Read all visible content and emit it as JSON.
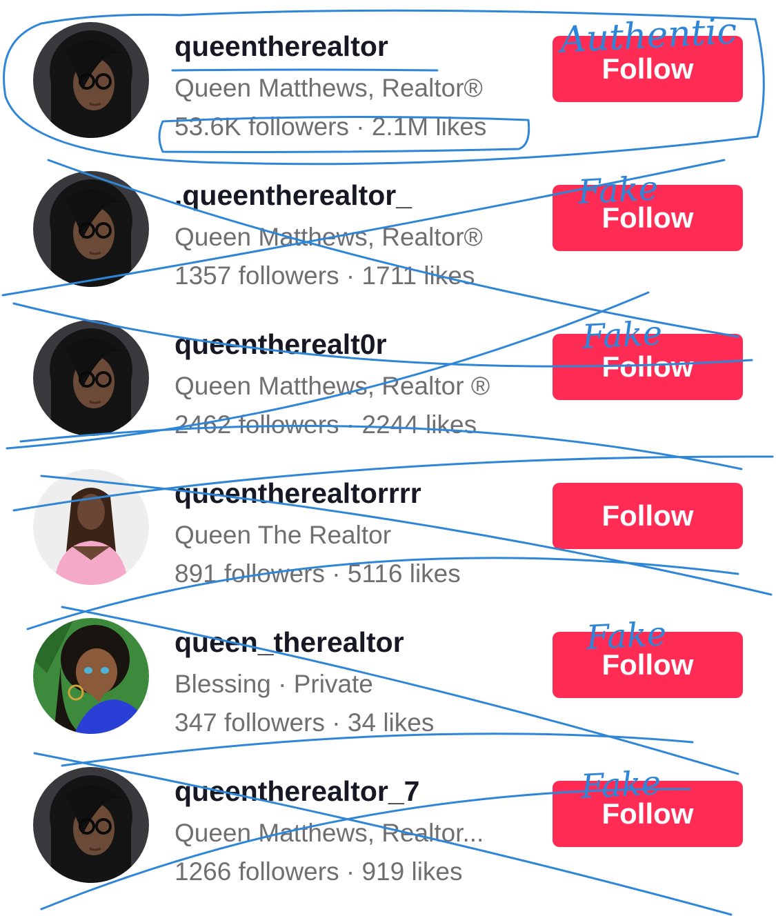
{
  "accounts": [
    {
      "username": "queentherealtor",
      "display_name": "Queen Matthews, Realtor®",
      "stats": "53.6K followers · 2.1M likes",
      "follow_label": "Follow",
      "avatar_icon": "profile-photo-woman-glasses"
    },
    {
      "username": ".queentherealtor_",
      "display_name": "Queen Matthews, Realtor®",
      "stats": "1357 followers · 1711 likes",
      "follow_label": "Follow",
      "avatar_icon": "profile-photo-woman-glasses"
    },
    {
      "username": "queentherealt0r",
      "display_name": "Queen Matthews, Realtor ®",
      "stats": "2462 followers · 2244 likes",
      "follow_label": "Follow",
      "avatar_icon": "profile-photo-woman-glasses"
    },
    {
      "username": "queentherealtorrrr",
      "display_name": "Queen The Realtor",
      "stats": "891 followers · 5116 likes",
      "follow_label": "Follow",
      "avatar_icon": "profile-photo-woman-pink-outfit"
    },
    {
      "username": "queen_therealtor",
      "display_name": "Blessing · Private",
      "stats": "347 followers · 34 likes",
      "follow_label": "Follow",
      "avatar_icon": "cartoon-avatar"
    },
    {
      "username": "queentherealtor_7",
      "display_name": "Queen Matthews, Realtor...",
      "stats": "1266 followers · 919 likes",
      "follow_label": "Follow",
      "avatar_icon": "profile-photo-woman-glasses"
    }
  ],
  "annotations": {
    "authentic": "Authentic",
    "fake_1": "Fake",
    "fake_2": "Fake",
    "fake_3": "Fake",
    "fake_4": "Fake"
  },
  "colors": {
    "follow_button": "#fe2c55",
    "username": "#161823",
    "secondary_text": "#6f6f73",
    "annotation_ink": "#2f86d6"
  }
}
